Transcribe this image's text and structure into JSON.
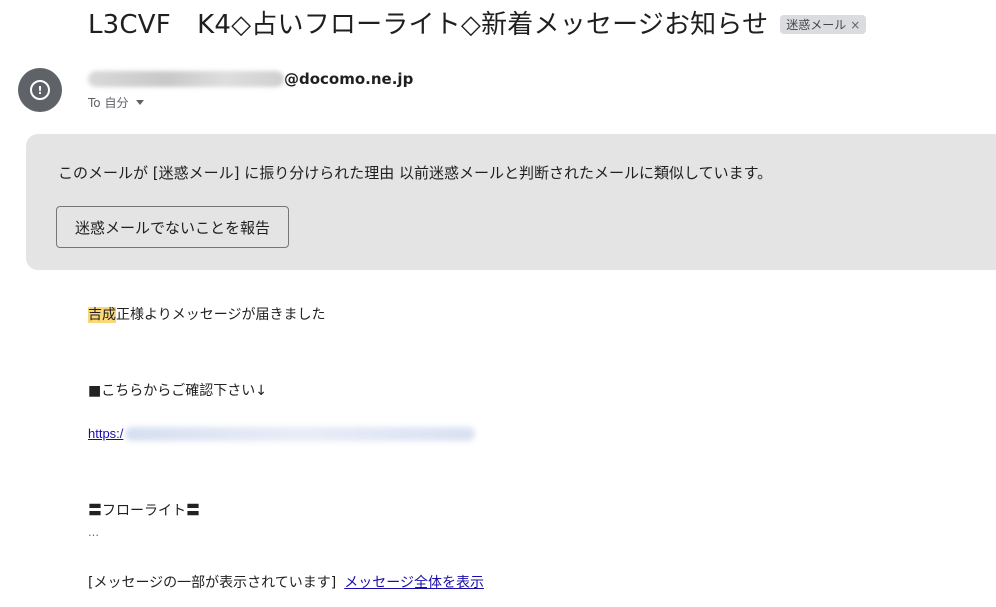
{
  "email": {
    "subject": "L3CVF　K4◇占いフローライト◇新着メッセージお知らせ",
    "labels": [
      {
        "text": "迷惑メール",
        "remove": "×"
      }
    ],
    "sender": {
      "domain": "@docomo.ne.jp",
      "avatar_icon": "alert-circle-icon",
      "avatar_glyph": "!"
    },
    "recipient": "To 自分",
    "spam_warning": {
      "text": "このメールが [迷惑メール] に振り分けられた理由 以前迷惑メールと判断されたメールに類似しています。",
      "button": "迷惑メールでないことを報告"
    },
    "body": {
      "greeting_highlight": "吉成",
      "greeting_rest": "正様よりメッセージが届きました",
      "prompt": "■こちらからご確認下さい↓",
      "link_prefix": "https:/",
      "brand": "〓フローライト〓",
      "ellipsis": "…",
      "clipped_notice": "[メッセージの一部が表示されています]",
      "view_full": "メッセージ全体を表示"
    }
  },
  "colors": {
    "warning_bg": "#e4e4e4",
    "highlight": "#fbd776",
    "link": "#1a0dab",
    "avatar_bg": "#5f6368"
  }
}
